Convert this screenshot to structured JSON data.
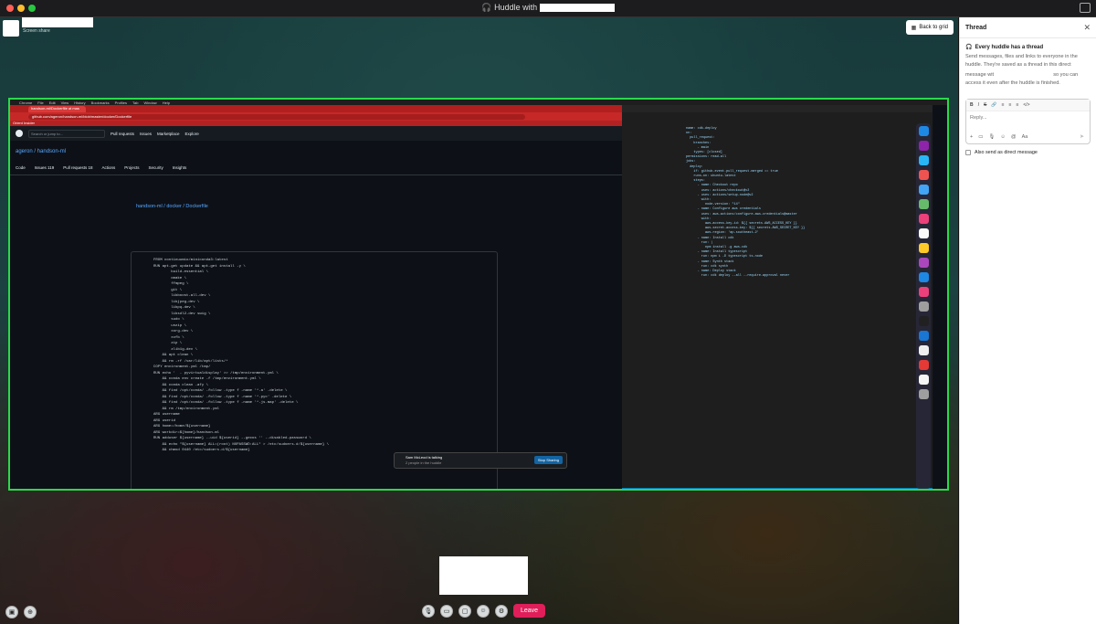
{
  "window": {
    "title_prefix": "🎧 Huddle with",
    "redacted_name": ""
  },
  "stage": {
    "presenter_sub": "Screen share",
    "back_to_grid_label": "Back to grid",
    "back_to_grid_icon": "grid-icon"
  },
  "shared_screen": {
    "menubar": [
      "Chrome",
      "File",
      "Edit",
      "View",
      "History",
      "Bookmarks",
      "Profiles",
      "Tab",
      "Window",
      "Help"
    ],
    "browser_tab": "handson-ml/Dockerfile at mas",
    "url": "github.com/ageron/handson-ml/blob/master/docker/Dockerfile",
    "bookmarks": "Orient   Insider",
    "gh_search": "Search or jump to...",
    "gh_nav": [
      "Pull requests",
      "Issues",
      "Marketplace",
      "Explore"
    ],
    "repo_name": "ageron / handson-ml",
    "repo_tabs": [
      "Code",
      "Issues 119",
      "Pull requests 18",
      "Actions",
      "Projects",
      "Security",
      "Insights"
    ],
    "file_path": "handson-ml / docker / Dockerfile",
    "code_lines": [
      "FROM continuumio/miniconda3:latest",
      "",
      "RUN apt-get update && apt-get install -y \\",
      "        build-essential \\",
      "        cmake \\",
      "        ffmpeg \\",
      "        git \\",
      "        libboost-all-dev \\",
      "        libjpeg-dev \\",
      "        libpq-dev \\",
      "        libsdl2-dev swig \\",
      "        sudo \\",
      "        unzip \\",
      "        xorg-dev \\",
      "        xvfb \\",
      "        zip \\",
      "        zlib1g-dev \\",
      "    && apt clean \\",
      "    && rm -rf /var/lib/apt/lists/*",
      "",
      "COPY environment.yml /tmp/",
      "RUN echo '  - pyvirtualdisplay' >> /tmp/environment.yml \\",
      "    && conda env create -f /tmp/environment.yml \\",
      "    && conda clean -afy \\",
      "    && find /opt/conda/ -follow -type f -name '*.a' -delete \\",
      "    && find /opt/conda/ -follow -type f -name '*.pyc' -delete \\",
      "    && find /opt/conda/ -follow -type f -name '*.js.map' -delete \\",
      "    && rm /tmp/environment.yml",
      "",
      "ARG username",
      "ARG userid",
      "",
      "ARG home=/home/${username}",
      "ARG workdir=${home}/handson-ml",
      "",
      "RUN adduser ${username} --uid ${userid} --gecos '' --disabled-password \\",
      "    && echo \"${username} ALL=(root) NOPASSWD:ALL\" > /etc/sudoers.d/${username} \\",
      "    && chmod 0440 /etc/sudoers.d/${username}"
    ],
    "editor_lines": [
      "name: cdk-deploy",
      "on:",
      "  pull_request:",
      "    branches:",
      "      - main",
      "    types: [closed]",
      "permissions: read-all",
      "jobs:",
      "  deploy:",
      "    if: github.event.pull_request.merged == true",
      "    runs-on: ubuntu-latest",
      "    steps:",
      "      - name: Checkout repo",
      "        uses: actions/checkout@v2",
      "      - uses: actions/setup-node@v2",
      "        with:",
      "          node-version: \"14\"",
      "      - name: Configure aws credentials",
      "        uses: aws-actions/configure-aws-credentials@master",
      "        with:",
      "          aws-access-key-id: ${{ secrets.AWS_ACCESS_KEY }}",
      "          aws-secret-access-key: ${{ secrets.AWS_SECRET_KEY }}",
      "          aws-region: 'ap-southeast-2'",
      "      - name: Install cdk",
      "        run: |",
      "          npm install -g aws-cdk",
      "      - name: Install typescript",
      "        run: npm i -D typescript ts-node",
      "      - name: Synth stack",
      "        run: cdk synth",
      "      - name: Deploy stack",
      "        run: cdk deploy --all --require-approval never"
    ],
    "huddle_status": "Sam McLeod is talking",
    "huddle_count": "2 people in the huddle",
    "stop_sharing": "Stop Sharing"
  },
  "controls": {
    "leave_label": "Leave"
  },
  "thread": {
    "title": "Thread",
    "info_title": "Every huddle has a thread",
    "info_body_1": "Send messages, files and links to everyone in the huddle. They're saved as a thread in this direct message wit",
    "info_body_2": "so you can access it even after the huddle is finished.",
    "reply_placeholder": "Reply...",
    "also_send_label": "Also send as direct message",
    "format_buttons": [
      "B",
      "I",
      "S",
      "🔗",
      "≡",
      "≡",
      "≡",
      "</>"
    ]
  },
  "colors": {
    "share_border": "#2bd94a",
    "leave": "#e01e5a",
    "stop_sharing": "#1264a3"
  }
}
